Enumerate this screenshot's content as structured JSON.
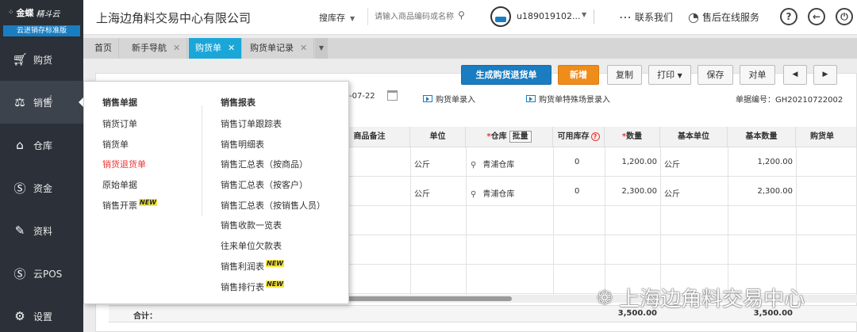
{
  "sidebar": {
    "brand": "金蝶",
    "brand_sub": "精斗云",
    "edition": "云进销存标准版",
    "items": [
      {
        "label": "购货",
        "icon": "cart-icon"
      },
      {
        "label": "销售",
        "icon": "sales-icon"
      },
      {
        "label": "仓库",
        "icon": "warehouse-icon"
      },
      {
        "label": "资金",
        "icon": "money-icon"
      },
      {
        "label": "资料",
        "icon": "pen-icon"
      },
      {
        "label": "云POS",
        "icon": "pos-icon"
      },
      {
        "label": "设置",
        "icon": "gear-icon"
      }
    ]
  },
  "header": {
    "company": "上海边角料交易中心有限公司",
    "search_type": "搜库存",
    "search_placeholder": "请输入商品编码或名称",
    "user": "u189019102...",
    "contact": "联系我们",
    "service": "售后在线服务"
  },
  "tabs": [
    {
      "label": "首页",
      "closable": false
    },
    {
      "label": "新手导航",
      "closable": true
    },
    {
      "label": "购货单",
      "closable": true,
      "active": true
    },
    {
      "label": "购货单记录",
      "closable": true
    }
  ],
  "toolbar": {
    "gen_return": "生成购货退货单",
    "new": "新增",
    "copy": "复制",
    "print": "打印",
    "save": "保存",
    "reconcile": "对单",
    "prev": "◀",
    "next": "▶"
  },
  "form": {
    "date": "-07-22",
    "entry1": "购货单录入",
    "entry2": "购货单特殊场景录入",
    "doc_no": "单据编号：GH20210722002"
  },
  "table": {
    "headers": {
      "note": "商品备注",
      "unit": "单位",
      "warehouse": "仓库",
      "batch": "批量",
      "stock": "可用库存",
      "qty": "数量",
      "base_unit": "基本单位",
      "base_qty": "基本数量",
      "cost": "购货单"
    },
    "rows": [
      {
        "unit": "公斤",
        "warehouse": "青浦仓库",
        "stock": "0",
        "qty": "1,200.00",
        "base_unit": "公斤",
        "base_qty": "1,200.00"
      },
      {
        "unit": "公斤",
        "warehouse": "青浦仓库",
        "stock": "0",
        "qty": "2,300.00",
        "base_unit": "公斤",
        "base_qty": "2,300.00"
      }
    ],
    "total_label": "合计：",
    "total_qty": "3,500.00",
    "total_base_qty": "3,500.00"
  },
  "menu": {
    "col1_title": "销售单据",
    "col1": [
      {
        "label": "销货订单"
      },
      {
        "label": "销货单"
      },
      {
        "label": "销货退货单",
        "highlight": true
      },
      {
        "label": "原始单据"
      },
      {
        "label": "销售开票",
        "new": true
      }
    ],
    "col2_title": "销售报表",
    "col2": [
      {
        "label": "销售订单跟踪表"
      },
      {
        "label": "销售明细表"
      },
      {
        "label": "销售汇总表（按商品）"
      },
      {
        "label": "销售汇总表（按客户）"
      },
      {
        "label": "销售汇总表（按销售人员）"
      },
      {
        "label": "销售收款一览表"
      },
      {
        "label": "往来单位欠款表"
      },
      {
        "label": "销售利润表",
        "new": true
      },
      {
        "label": "销售排行表",
        "new": true
      }
    ],
    "new_badge": "NEW"
  },
  "watermark": "上海边角料交易中心"
}
